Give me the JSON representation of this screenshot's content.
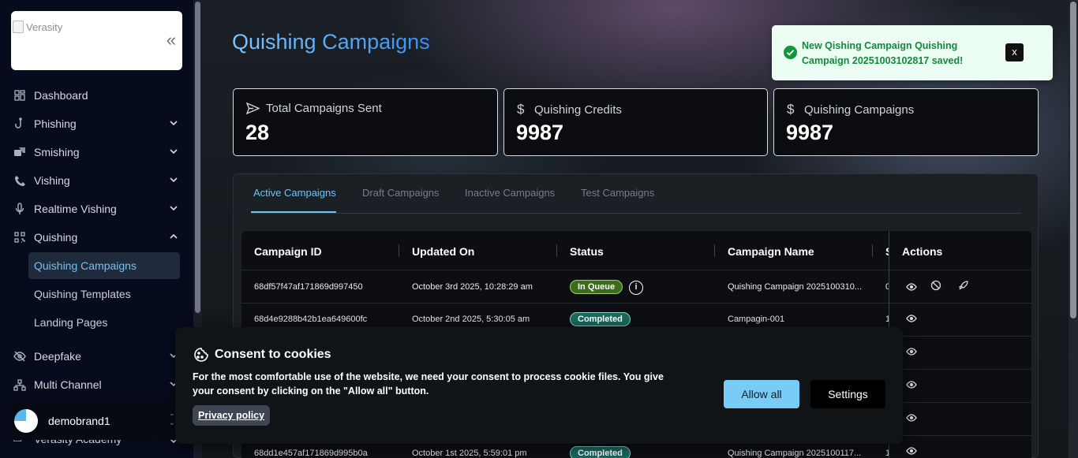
{
  "sidebar": {
    "logo_alt": "Verasity",
    "collapse_glyph": "«",
    "items": [
      {
        "label": "Dashboard",
        "icon": "dashboard-icon"
      },
      {
        "label": "Phishing",
        "icon": "hook-icon"
      },
      {
        "label": "Smishing",
        "icon": "chat-icon"
      },
      {
        "label": "Vishing",
        "icon": "phone-icon"
      },
      {
        "label": "Realtime Vishing",
        "icon": "microphone-icon"
      },
      {
        "label": "Quishing",
        "icon": "qr-code-icon"
      },
      {
        "label": "Deepfake",
        "icon": "eye-off-icon"
      },
      {
        "label": "Multi Channel",
        "icon": "network-icon"
      },
      {
        "label": "Verasity Academy",
        "icon": "academy-icon"
      }
    ],
    "quishing_sub": [
      "Quishing Campaigns",
      "Quishing Templates",
      "Landing Pages"
    ],
    "brand": "demobrand1"
  },
  "page": {
    "title": "Quishing Campaigns"
  },
  "stats": [
    {
      "label": "Total Campaigns Sent",
      "value": "28",
      "icon": "send-icon"
    },
    {
      "label": "Quishing Credits",
      "value": "9987",
      "icon": "dollar-icon"
    },
    {
      "label": "Quishing Campaigns",
      "value": "9987",
      "icon": "dollar-icon"
    }
  ],
  "tabs": [
    "Active Campaigns",
    "Draft Campaigns",
    "Inactive Campaigns",
    "Test Campaigns"
  ],
  "table": {
    "headers": [
      "Campaign ID",
      "Updated On",
      "Status",
      "Campaign Name",
      "S",
      "Actions"
    ],
    "rows": [
      {
        "id": "68df57f47af171869d997450",
        "updated": "October 3rd 2025, 10:28:29 am",
        "status": "In Queue",
        "name": "Quishing Campaign 2025100310...",
        "s": "0"
      },
      {
        "id": "68d4e9288b42b1ea649600fc",
        "updated": "October 2nd 2025, 5:30:05 am",
        "status": "Completed",
        "name": "Campagin-001",
        "s": "1"
      },
      {
        "id": "",
        "updated": "",
        "status": "",
        "name": "",
        "s": ""
      },
      {
        "id": "",
        "updated": "",
        "status": "",
        "name": "",
        "s": ""
      },
      {
        "id": "",
        "updated": "",
        "status": "",
        "name": "",
        "s": ""
      },
      {
        "id": "68dd1e457af171869d995b0a",
        "updated": "October 1st 2025, 5:59:01 pm",
        "status": "Completed",
        "name": "Quishing Campaign 2025100117...",
        "s": "1"
      }
    ]
  },
  "toast": {
    "message": "New Qishing Campaign Quishing Campaign 20251003102817 saved!",
    "close": "x"
  },
  "cookie": {
    "title": "Consent to cookies",
    "text": "For the most comfortable use of the website, we need your consent to process cookie files. You give your consent by clicking on the \"Allow all\" button.",
    "privacy": "Privacy policy",
    "allow": "Allow all",
    "settings": "Settings"
  },
  "colors": {
    "accent": "#6ec3f5",
    "sidebar_bg": "#060b1e",
    "badge_queue": "#3c6a1f",
    "badge_done": "#1a6a60",
    "toast_bg": "#ecfdf3",
    "toast_text": "#138a3a"
  }
}
